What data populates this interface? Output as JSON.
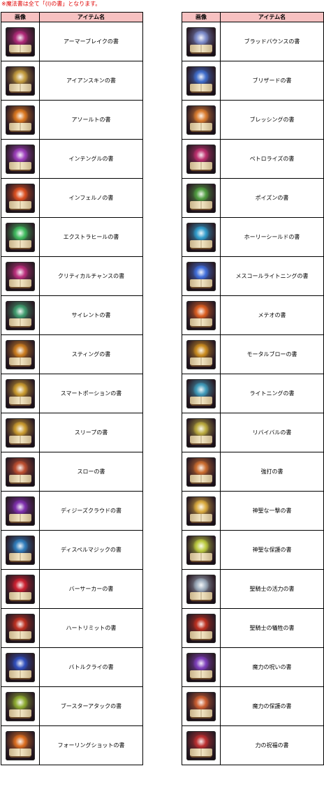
{
  "note": "※魔法書は全て「(I)の書」となります。",
  "headers": {
    "image": "画像",
    "name": "アイテム名"
  },
  "left": [
    {
      "name": "アーマーブレイクの書",
      "icon": "armor-break-icon",
      "color": "#b22a7a"
    },
    {
      "name": "アイアンスキンの書",
      "icon": "iron-skin-icon",
      "color": "#c8a040"
    },
    {
      "name": "アソールトの書",
      "icon": "assault-icon",
      "color": "#e07a20"
    },
    {
      "name": "インテングルの書",
      "icon": "entangle-icon",
      "color": "#a040c0"
    },
    {
      "name": "インフェルノの書",
      "icon": "inferno-icon",
      "color": "#e05020"
    },
    {
      "name": "エクストラヒールの書",
      "icon": "extra-heal-icon",
      "color": "#40c060"
    },
    {
      "name": "クリティカルチャンスの書",
      "icon": "critical-chance-icon",
      "color": "#c03080"
    },
    {
      "name": "サイレントの書",
      "icon": "silent-icon",
      "color": "#40a070"
    },
    {
      "name": "スティングの書",
      "icon": "sting-icon",
      "color": "#d08020"
    },
    {
      "name": "スマートポーションの書",
      "icon": "smart-potion-icon",
      "color": "#d0a030"
    },
    {
      "name": "スリープの書",
      "icon": "sleep-icon",
      "color": "#d0a030"
    },
    {
      "name": "スローの書",
      "icon": "slow-icon",
      "color": "#c05030"
    },
    {
      "name": "ディジーズクラウドの書",
      "icon": "disease-cloud-icon",
      "color": "#8030b0"
    },
    {
      "name": "ディスペルマジックの書",
      "icon": "dispel-magic-icon",
      "color": "#3080c0"
    },
    {
      "name": "バーサーカーの書",
      "icon": "berserker-icon",
      "color": "#d02030"
    },
    {
      "name": "ハートリミットの書",
      "icon": "heart-limit-icon",
      "color": "#c03020"
    },
    {
      "name": "バトルクライの書",
      "icon": "battle-cry-icon",
      "color": "#3050c0"
    },
    {
      "name": "ブースターアタックの書",
      "icon": "booster-attack-icon",
      "color": "#90b030"
    },
    {
      "name": "フォーリングショットの書",
      "icon": "falling-shot-icon",
      "color": "#e07020"
    }
  ],
  "right": [
    {
      "name": "ブラッドバウンスの書",
      "icon": "blood-bounce-icon",
      "color": "#8090d0"
    },
    {
      "name": "ブリザードの書",
      "icon": "blizzard-icon",
      "color": "#4070d0"
    },
    {
      "name": "ブレッシングの書",
      "icon": "blessing-icon",
      "color": "#e08030"
    },
    {
      "name": "ペトロライズの書",
      "icon": "petrolize-icon",
      "color": "#c03070"
    },
    {
      "name": "ポイズンの書",
      "icon": "poison-icon",
      "color": "#50a040"
    },
    {
      "name": "ホーリーシールドの書",
      "icon": "holy-shield-icon",
      "color": "#30a0d0"
    },
    {
      "name": "メスコールライトニングの書",
      "icon": "mass-call-lightning-icon",
      "color": "#4070e0"
    },
    {
      "name": "メテオの書",
      "icon": "meteor-icon",
      "color": "#e06020"
    },
    {
      "name": "モータルブローの書",
      "icon": "mortal-blow-icon",
      "color": "#d09020"
    },
    {
      "name": "ライトニングの書",
      "icon": "lightning-icon",
      "color": "#40a0c0"
    },
    {
      "name": "リバイバルの書",
      "icon": "revival-icon",
      "color": "#c0b040"
    },
    {
      "name": "強打の書",
      "icon": "strong-blow-icon",
      "color": "#d07030"
    },
    {
      "name": "神聖な一撃の書",
      "icon": "holy-strike-icon",
      "color": "#e0b040"
    },
    {
      "name": "神聖な保護の書",
      "icon": "holy-protection-icon",
      "color": "#c0d040"
    },
    {
      "name": "聖騎士の活力の書",
      "icon": "paladin-vitality-icon",
      "color": "#a0b0c0"
    },
    {
      "name": "聖騎士の犠牲の書",
      "icon": "paladin-sacrifice-icon",
      "color": "#c03020"
    },
    {
      "name": "魔力の呪いの書",
      "icon": "mana-curse-icon",
      "color": "#8040c0"
    },
    {
      "name": "魔力の保護の書",
      "icon": "mana-protection-icon",
      "color": "#d06030"
    },
    {
      "name": "力の祝福の書",
      "icon": "str-blessing-icon",
      "color": "#c03030"
    }
  ]
}
